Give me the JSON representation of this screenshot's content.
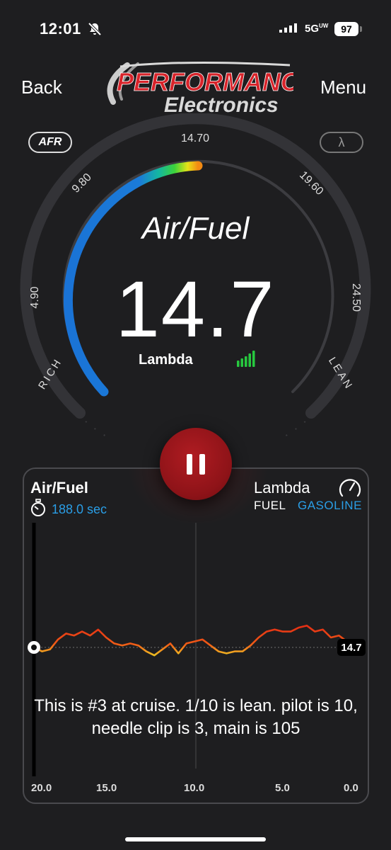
{
  "status_bar": {
    "time": "12:01",
    "network": "5G",
    "network_sub": "UW",
    "battery": "97"
  },
  "header": {
    "back": "Back",
    "menu": "Menu",
    "logo_line1": "PERFORMANCE",
    "logo_line2": "Electronics"
  },
  "mode_toggle": {
    "afr": "AFR",
    "lambda": "λ"
  },
  "gauge": {
    "title": "Air/Fuel",
    "value": "14.7",
    "unit_label": "Lambda",
    "scale_labels": [
      "4.90",
      "9.80",
      "14.70",
      "19.60",
      "24.50"
    ],
    "rich_label": "RICH",
    "lean_label": "LEAN",
    "signal_strength": 5
  },
  "panel": {
    "title": "Air/Fuel",
    "elapsed": "188.0 sec",
    "right_title": "Lambda",
    "fuel_label": "FUEL",
    "fuel_value": "GASOLINE",
    "current_value": "14.7",
    "note": "This is #3 at cruise. 1/10 is lean. pilot is 10, needle clip is 3, main is 105",
    "x_ticks": [
      "20.0",
      "15.0",
      "10.0",
      "5.0",
      "0.0"
    ]
  },
  "chart_data": {
    "type": "line",
    "x": [
      20.0,
      19.5,
      19.0,
      18.5,
      18.0,
      17.5,
      17.0,
      16.5,
      16.0,
      15.5,
      15.0,
      14.5,
      14.0,
      13.5,
      13.0,
      12.5,
      12.0,
      11.5,
      11.0,
      10.5,
      10.0,
      9.5,
      9.0,
      8.5,
      8.0,
      7.5,
      7.0,
      6.5,
      6.0,
      5.5,
      5.0,
      4.5,
      4.0,
      3.5,
      3.0,
      2.5,
      2.0,
      1.5,
      1.0,
      0.5,
      0.0
    ],
    "values": [
      14.7,
      14.5,
      14.6,
      15.1,
      15.4,
      15.3,
      15.5,
      15.3,
      15.6,
      15.2,
      14.9,
      14.8,
      14.9,
      14.8,
      14.5,
      14.3,
      14.6,
      14.9,
      14.4,
      14.9,
      15.0,
      15.1,
      14.8,
      14.5,
      14.4,
      14.5,
      14.5,
      14.8,
      15.2,
      15.5,
      15.6,
      15.5,
      15.5,
      15.7,
      15.8,
      15.5,
      15.6,
      15.2,
      15.3,
      15.0,
      14.9
    ],
    "series_name": "Air/Fuel",
    "xlim": [
      20.0,
      0.0
    ],
    "reference_line": 14.7,
    "grid": false
  },
  "colors": {
    "accent_blue": "#2a9ee6",
    "pause_red": "#9e171d",
    "signal_green": "#27c93f"
  }
}
